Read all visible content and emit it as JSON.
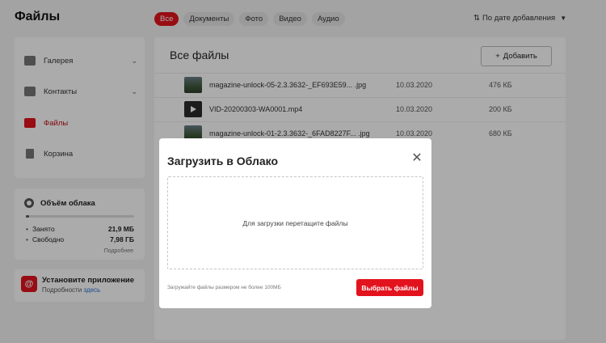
{
  "app": {
    "brand": "Файлы"
  },
  "filters": [
    {
      "label": "Все",
      "active": true
    },
    {
      "label": "Документы"
    },
    {
      "label": "Фото"
    },
    {
      "label": "Видео"
    },
    {
      "label": "Аудио"
    }
  ],
  "sort": {
    "label": "По дате добавления"
  },
  "sidebar": {
    "items": [
      {
        "label": "Галерея",
        "icon": "gallery-icon",
        "expandable": true
      },
      {
        "label": "Контакты",
        "icon": "contacts-icon",
        "expandable": true
      },
      {
        "label": "Файлы",
        "icon": "folder-icon",
        "active": true
      },
      {
        "label": "Корзина",
        "icon": "trash-icon"
      }
    ]
  },
  "storage": {
    "title": "Объём облака",
    "used_fraction": 0.03,
    "used_label": "Занято",
    "used_value": "21,9 МБ",
    "free_label": "Свободно",
    "free_value": "7,98 ГБ",
    "more": "Подробнее"
  },
  "promo": {
    "title": "Установите приложение",
    "details_prefix": "Подробности",
    "details_link": "здесь"
  },
  "main": {
    "heading": "Все файлы",
    "add_button": "Добавить",
    "files": [
      {
        "name": "magazine-unlock-05-2.3.3632-_EF693E59... .jpg",
        "date": "10.03.2020",
        "size": "476 КБ",
        "kind": "image"
      },
      {
        "name": "VID-20200303-WA0001.mp4",
        "date": "10.03.2020",
        "size": "200 КБ",
        "kind": "video"
      },
      {
        "name": "magazine-unlock-01-2.3.3632-_6FAD8227F... .jpg",
        "date": "10.03.2020",
        "size": "680 КБ",
        "kind": "image"
      }
    ]
  },
  "modal": {
    "title": "Загрузить в Облако",
    "drop_hint": "Для загрузки перетащите файлы",
    "limit_note": "Загружайте файлы размером не более 100МБ",
    "choose_button": "Выбрать файлы"
  },
  "colors": {
    "accent": "#e3131e",
    "link": "#2a6fd6"
  }
}
